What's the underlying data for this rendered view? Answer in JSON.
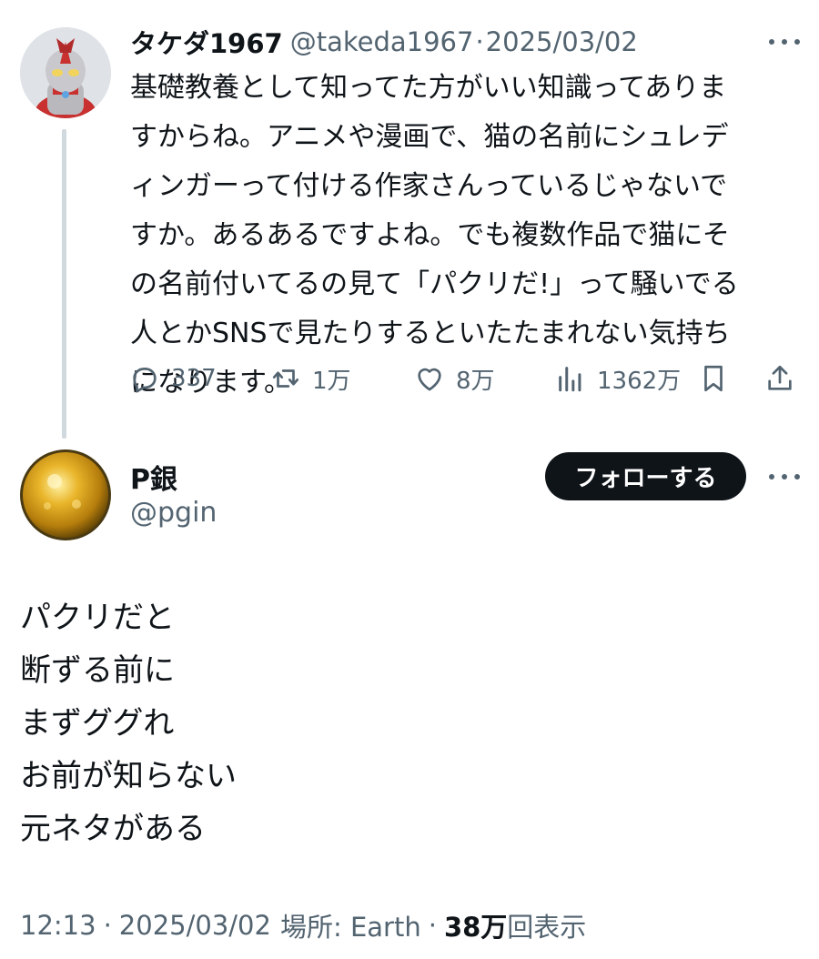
{
  "parent_tweet": {
    "display_name": "タケダ1967",
    "handle": "@takeda1967",
    "separator": "·",
    "date": "2025/03/02",
    "text_lines": [
      "基礎教養として知ってた方がいい知識ってありま",
      "すからね。アニメや漫画で、猫の名前にシュレデ",
      "ィンガーって付ける作家さんっているじゃないで",
      "すか。あるあるですよね。でも複数作品で猫にそ",
      "の名前付いてるの見て「パクリだ!」って騒いでる",
      "人とかSNSで見たりするといたたまれない気持ち",
      "になります。"
    ],
    "actions": {
      "replies": "337",
      "retweets": "1万",
      "likes": "8万",
      "views": "1362万"
    },
    "icons": {
      "avatar": "ultraman-figure-avatar",
      "more": "more-icon",
      "reply": "reply-icon",
      "retweet": "retweet-icon",
      "like": "heart-icon",
      "views": "views-icon",
      "bookmark": "bookmark-icon",
      "share": "share-icon"
    }
  },
  "reply_tweet": {
    "display_name": "P銀",
    "handle": "@pgin",
    "follow_label": "フォローする",
    "text_lines": [
      "パクリだと",
      "断ずる前に",
      "まずググれ",
      "お前が知らない",
      "元ネタがある"
    ],
    "meta": {
      "time": "12:13",
      "sep1": "·",
      "date": "2025/03/02",
      "location": "場所: Earth",
      "sep2": "·",
      "views_count": "38万",
      "views_label": "回表示"
    }
  },
  "colors": {
    "text_primary": "#0f1419",
    "text_secondary": "#536471",
    "thread_line": "#cfd9de",
    "follow_button_bg": "#0f1419",
    "follow_button_text": "#ffffff"
  }
}
